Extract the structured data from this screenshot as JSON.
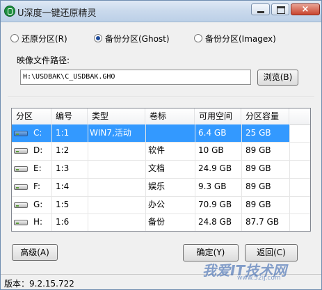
{
  "window": {
    "title": "U深度一键还原精灵",
    "close_glyph": "×"
  },
  "modes": [
    {
      "label": "还原分区(R)",
      "selected": false
    },
    {
      "label": "备份分区(Ghost)",
      "selected": true
    },
    {
      "label": "备份分区(Imagex)",
      "selected": false
    }
  ],
  "image_path": {
    "label": "映像文件路径:",
    "value": "H:\\USDBAK\\C_USDBAK.GHO",
    "browse_label": "浏览(B)"
  },
  "partition_table": {
    "columns": [
      "分区",
      "编号",
      "类型",
      "卷标",
      "可用空间",
      "分区容量"
    ],
    "rows": [
      {
        "drive": "C:",
        "id": "1:1",
        "type": "WIN7,活动",
        "label": "",
        "free": "6.4 GB",
        "size": "25 GB",
        "selected": true
      },
      {
        "drive": "D:",
        "id": "1:2",
        "type": "",
        "label": "软件",
        "free": "10 GB",
        "size": "89 GB",
        "selected": false
      },
      {
        "drive": "E:",
        "id": "1:3",
        "type": "",
        "label": "文档",
        "free": "24.9 GB",
        "size": "89 GB",
        "selected": false
      },
      {
        "drive": "F:",
        "id": "1:4",
        "type": "",
        "label": "娱乐",
        "free": "9.3 GB",
        "size": "89 GB",
        "selected": false
      },
      {
        "drive": "G:",
        "id": "1:5",
        "type": "",
        "label": "办公",
        "free": "70.9 GB",
        "size": "89 GB",
        "selected": false
      },
      {
        "drive": "H:",
        "id": "1:6",
        "type": "",
        "label": "备份",
        "free": "24.8 GB",
        "size": "87.7 GB",
        "selected": false
      }
    ]
  },
  "buttons": {
    "advanced": "高级(A)",
    "ok": "确定(Y)",
    "back": "返回(C)"
  },
  "status": {
    "version": "版本：9.2.15.722"
  },
  "watermark": {
    "text": "我爱IT技术网",
    "url": "www.52ij.com"
  }
}
